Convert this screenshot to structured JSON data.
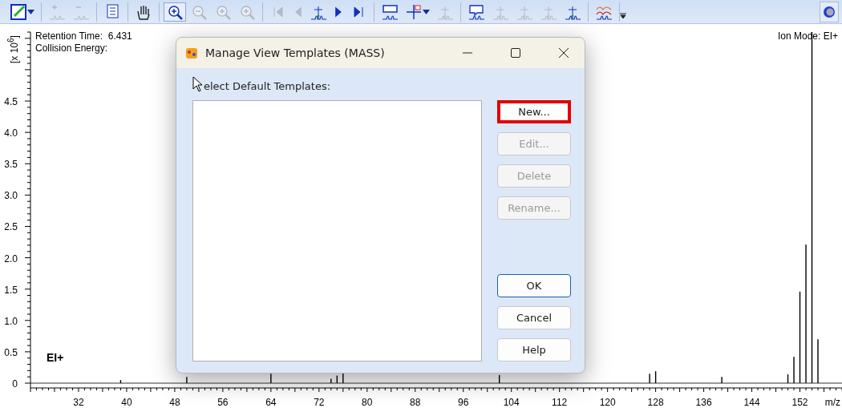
{
  "toolbar": {
    "groups": [
      [
        {
          "disabled": false,
          "selected": false,
          "dropdown": true
        }
      ],
      [
        {
          "disabled": true,
          "selected": false,
          "dropdown": false
        },
        {
          "disabled": true,
          "selected": false,
          "dropdown": false
        }
      ],
      [
        {
          "disabled": false,
          "selected": false,
          "dropdown": false
        }
      ],
      [
        {
          "disabled": false,
          "selected": false,
          "dropdown": false
        }
      ],
      [
        {
          "disabled": false,
          "selected": true,
          "dropdown": false
        },
        {
          "disabled": true,
          "selected": false,
          "dropdown": false
        },
        {
          "disabled": true,
          "selected": false,
          "dropdown": false
        },
        {
          "disabled": true,
          "selected": false,
          "dropdown": false
        }
      ],
      [
        {
          "disabled": true,
          "selected": false,
          "dropdown": false
        },
        {
          "disabled": true,
          "selected": false,
          "dropdown": false
        },
        {
          "disabled": false,
          "selected": false,
          "dropdown": false
        },
        {
          "disabled": false,
          "selected": false,
          "dropdown": false
        },
        {
          "disabled": false,
          "selected": false,
          "dropdown": false
        }
      ],
      [
        {
          "disabled": false,
          "selected": false,
          "dropdown": false
        },
        {
          "disabled": false,
          "selected": false,
          "dropdown": true
        },
        {
          "disabled": true,
          "selected": false,
          "dropdown": false
        }
      ],
      [
        {
          "disabled": false,
          "selected": false,
          "dropdown": false
        },
        {
          "disabled": true,
          "selected": false,
          "dropdown": false
        },
        {
          "disabled": true,
          "selected": false,
          "dropdown": false
        },
        {
          "disabled": true,
          "selected": false,
          "dropdown": false
        },
        {
          "disabled": false,
          "selected": false,
          "dropdown": false
        }
      ],
      [
        {
          "disabled": false,
          "selected": false,
          "dropdown": false
        }
      ]
    ]
  },
  "spectrum": {
    "retention_time": "Retention Time:  6.431",
    "collision_energy": "Collision Energy:",
    "ion_mode": "Ion Mode: EI+",
    "mode_label": "EI+",
    "chart_data": {
      "type": "bar",
      "xlabel": "m/z",
      "ylabel": "[x 10$^{6}$]",
      "x": [
        39,
        50,
        51,
        64,
        74,
        75,
        76,
        77,
        102,
        115,
        127,
        128,
        139,
        150,
        151,
        152,
        153,
        154,
        155
      ],
      "values": [
        0.05,
        0.1,
        null,
        0.15,
        0.07,
        0.12,
        0.16,
        null,
        0.13,
        null,
        0.15,
        0.19,
        0.1,
        0.14,
        0.42,
        1.46,
        2.21,
        5.6,
        0.7
      ],
      "xlim": [
        24,
        159
      ],
      "ylim": [
        0,
        5.6
      ],
      "xticks": [
        32,
        40,
        48,
        56,
        64,
        72,
        80,
        88,
        96,
        104,
        112,
        120,
        128,
        136,
        144,
        152
      ],
      "yticks": [
        {
          "value": 0,
          "label": "0"
        },
        {
          "value": 0.5,
          "label": "0.5"
        },
        {
          "value": 1,
          "label": "1.0"
        },
        {
          "value": 1.5,
          "label": "1.5"
        },
        {
          "value": 2,
          "label": "2.0"
        },
        {
          "value": 2.5,
          "label": "2.5"
        },
        {
          "value": 3,
          "label": "3.0"
        },
        {
          "value": 3.5,
          "label": "3.5"
        },
        {
          "value": 4,
          "label": "4.0"
        },
        {
          "value": 4.5,
          "label": "4.5"
        }
      ]
    }
  },
  "dialog": {
    "title": "Manage View Templates (MASS)",
    "label": "elect Default Templates:",
    "buttons": [
      {
        "label": "New...",
        "disabled": false,
        "highlighted": true,
        "default": false
      },
      {
        "label": "Edit...",
        "disabled": true,
        "highlighted": false,
        "default": false
      },
      {
        "label": "Delete",
        "disabled": true,
        "highlighted": false,
        "default": false
      },
      {
        "label": "Rename...",
        "disabled": true,
        "highlighted": false,
        "default": false
      }
    ],
    "footer_buttons": [
      {
        "label": "OK",
        "disabled": false,
        "highlighted": false,
        "default": true
      },
      {
        "label": "Cancel",
        "disabled": false,
        "highlighted": false,
        "default": false
      },
      {
        "label": "Help",
        "disabled": false,
        "highlighted": false,
        "default": false
      }
    ]
  }
}
